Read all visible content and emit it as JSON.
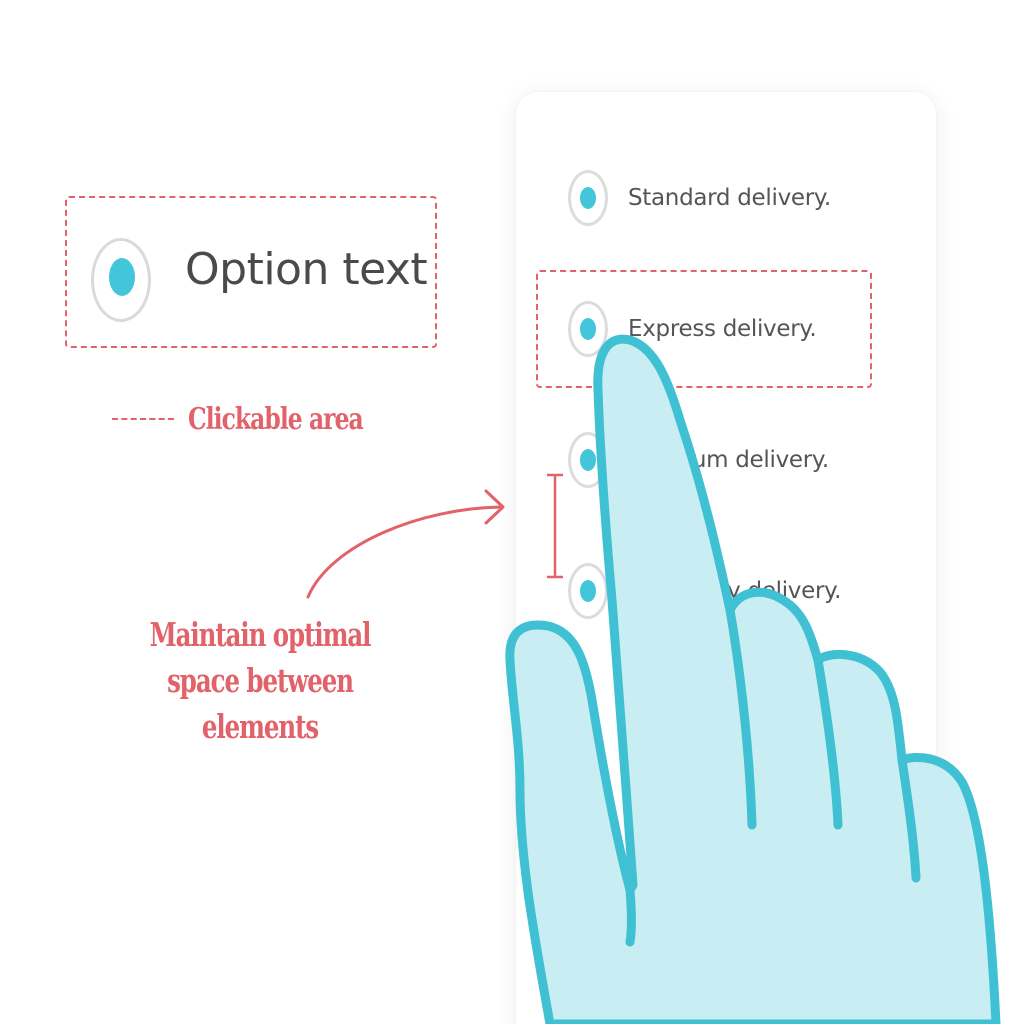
{
  "colors": {
    "accent": "#43c6d9",
    "annotation": "#e2626a",
    "hand_fill": "#c8edf2",
    "hand_outline": "#3fc1d3"
  },
  "example": {
    "option_label": "Option text",
    "radio_selected": true
  },
  "legend": {
    "label": "Clickable area"
  },
  "caption": {
    "lines": [
      "Maintain optimal",
      "space between",
      "elements"
    ]
  },
  "phone": {
    "options": [
      {
        "label": "Standard delivery."
      },
      {
        "label": "Express delivery."
      },
      {
        "label": "Premium delivery."
      },
      {
        "label": "Same day delivery."
      }
    ]
  },
  "icons": {
    "hand": "hand-pointer-icon",
    "arrow": "curved-arrow-icon",
    "bracket": "spacing-bracket-icon"
  }
}
